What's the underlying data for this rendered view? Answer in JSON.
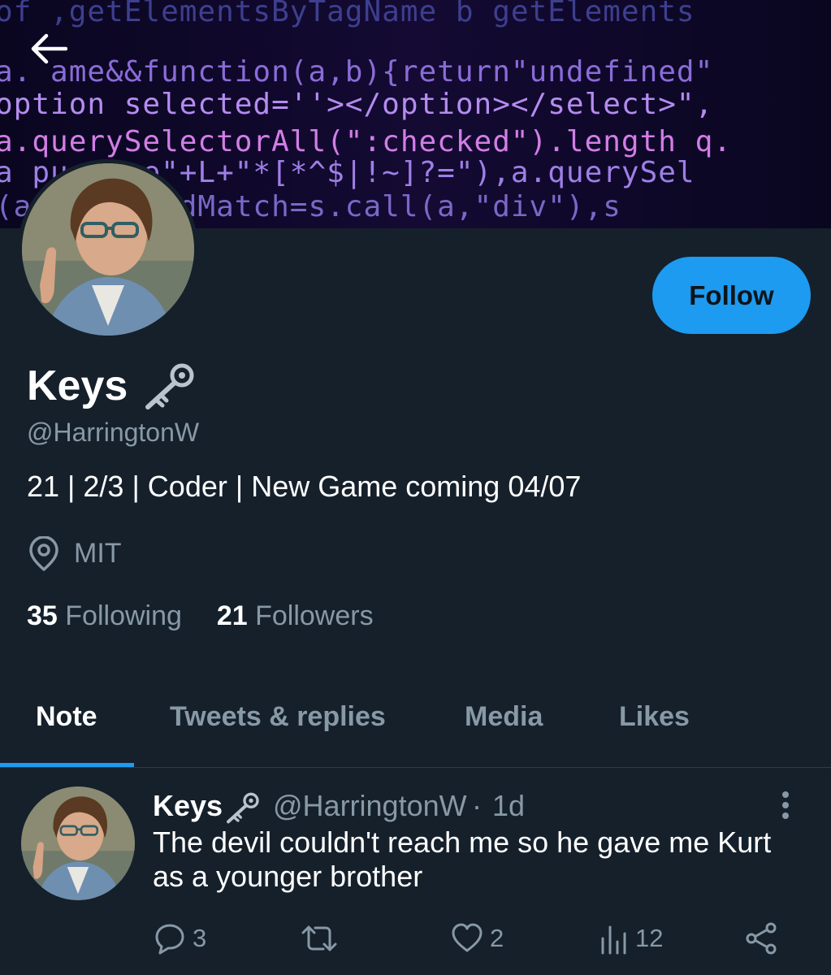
{
  "banner": {
    "code_lines": [
      "  of  ,getElementsByTagName b  getElements",
      " a. ame&&function(a,b){return\"undefined\"",
      "option selected=''></option></select>\",",
      "a.querySelectorAll(\":checked\").length  q.",
      "a pu   name\"+L+\"*[*^$|!~]?=\"),a.querySel",
      "(a    onnectedMatch=s.call(a,\"div\"),s"
    ]
  },
  "nav": {
    "back_icon": "arrow-left-icon"
  },
  "profile": {
    "display_name": "Keys",
    "name_icon": "key-icon",
    "handle": "@HarringtonW",
    "bio": "21 | 2/3 | Coder | New Game coming 04/07",
    "location_icon": "location-pin-icon",
    "location": "MIT",
    "following_count": "35",
    "following_label": "Following",
    "followers_count": "21",
    "followers_label": "Followers",
    "follow_button_label": "Follow"
  },
  "tabs": [
    {
      "label": "Note",
      "active": true
    },
    {
      "label": "Tweets & replies",
      "active": false
    },
    {
      "label": "Media",
      "active": false
    },
    {
      "label": "Likes",
      "active": false
    }
  ],
  "tweet": {
    "author_name": "Keys",
    "author_handle": "@HarringtonW",
    "separator": "·",
    "time": "1d",
    "text": "The devil couldn't reach me so he gave me Kurt as a younger brother",
    "actions": {
      "reply_count": "3",
      "retweet_count": "",
      "like_count": "2",
      "views_count": "12"
    }
  },
  "colors": {
    "background": "#15202b",
    "accent": "#1d9bf0",
    "secondary_text": "#8899a6",
    "primary_text": "#ffffff"
  }
}
